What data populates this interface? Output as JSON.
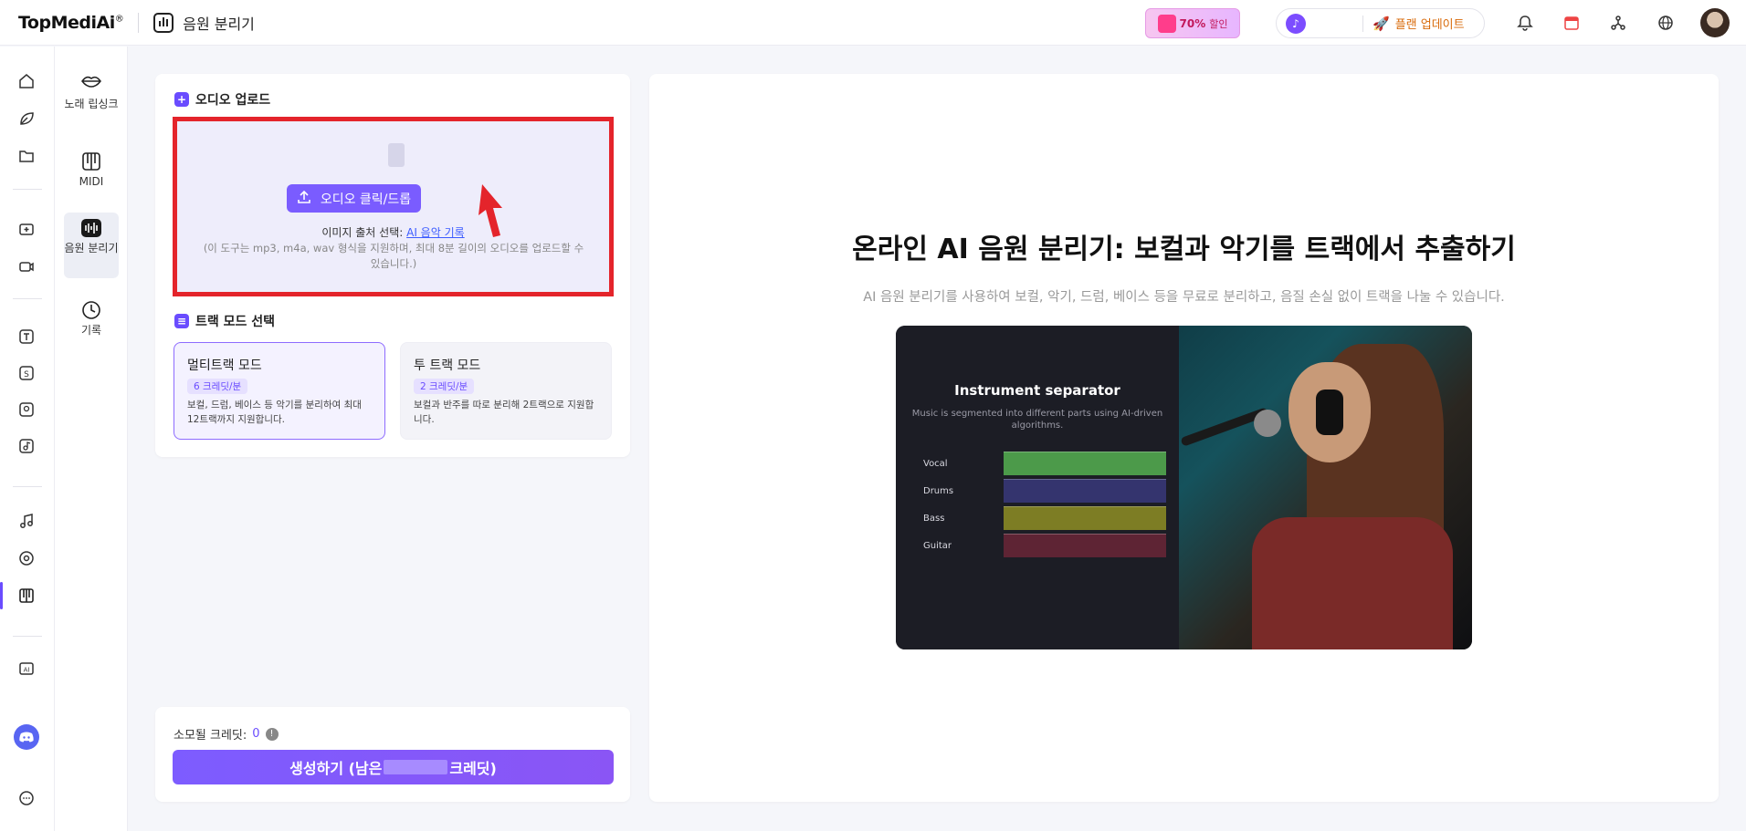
{
  "app": {
    "logo": "TopMediAi",
    "logo_mark": "®",
    "page_title": "음원 분리기"
  },
  "topbar": {
    "promo_percent": "70%",
    "promo_label": "할인",
    "plan_update": "플랜 업데이트",
    "icons": [
      "bell-icon",
      "calendar-icon",
      "share-nodes-icon",
      "globe-icon",
      "avatar"
    ]
  },
  "rail": {
    "icons": [
      "home-icon",
      "leaf-icon",
      "folder-icon",
      "video-add-icon",
      "camera-icon",
      "text-to-speech-icon",
      "dollar-icon",
      "voice-icon",
      "music-edit-icon",
      "music-note-icon",
      "disc-icon",
      "piano-icon",
      "ai-icon",
      "discord-icon",
      "chat-icon"
    ],
    "active": "piano-icon"
  },
  "subnav": {
    "items": [
      {
        "label": "노래 립싱크",
        "icon": "lips-icon"
      },
      {
        "label": "MIDI",
        "icon": "piano-keys-icon"
      },
      {
        "label": "음원 분리기",
        "icon": "waveform-icon"
      },
      {
        "label": "기록",
        "icon": "clock-icon"
      }
    ]
  },
  "upload": {
    "section_title": "오디오 업로드",
    "button_label": "오디오 클릭/드롭",
    "source_label": "이미지 출처 선택:",
    "source_link": "AI 음악 기록",
    "note": "(이 도구는 mp3, m4a, wav 형식을 지원하며, 최대 8분 길이의 오디오를 업로드할 수 있습니다.)"
  },
  "modes": {
    "section_title": "트랙 모드 선택",
    "items": [
      {
        "title": "멀티트랙 모드",
        "chip": "6 크레딧/분",
        "desc": "보컬, 드럼, 베이스 등 악기를 분리하여 최대 12트랙까지 지원합니다.",
        "selected": true
      },
      {
        "title": "투 트랙 모드",
        "chip": "2 크레딧/분",
        "desc": "보컬과 반주를 따로 분리해 2트랙으로 지원합니다.",
        "selected": false
      }
    ]
  },
  "generate": {
    "cost_label": "소모될 크레딧:",
    "cost_value": "0",
    "button_prefix": "생성하기 (남은",
    "button_suffix": "크레딧)"
  },
  "hero": {
    "title": "온라인 AI 음원 분리기: 보컬과 악기를 트랙에서 추출하기",
    "subtitle": "AI 음원 분리기를 사용하여 보컬, 악기, 드럼, 베이스 등을 무료로 분리하고, 음질 손실 없이 트랙을 나눌 수 있습니다.",
    "image_title": "Instrument separator",
    "image_subtitle": "Music is segmented into different parts using AI-driven algorithms.",
    "tracks": [
      {
        "name": "Vocal",
        "color": "#4c9a4a"
      },
      {
        "name": "Drums",
        "color": "#3a3a8a"
      },
      {
        "name": "Bass",
        "color": "#8a8a2a"
      },
      {
        "name": "Guitar",
        "color": "#6a2a3a"
      }
    ]
  },
  "colors": {
    "accent": "#7a5cff",
    "highlight_border": "#e4242b"
  }
}
